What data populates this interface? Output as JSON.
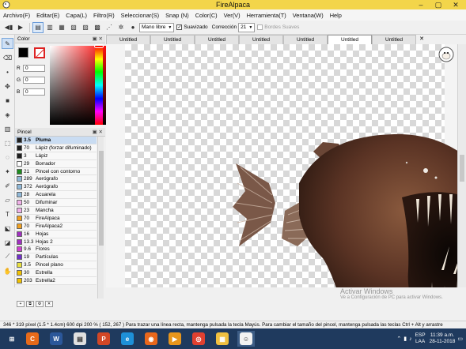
{
  "window": {
    "title": "FireAlpaca",
    "controls": [
      "–",
      "▢",
      "✕"
    ]
  },
  "menu": [
    "Archivo(F)",
    "Editar(E)",
    "Capa(L)",
    "Filtro(R)",
    "Seleccionar(S)",
    "Snap (N)",
    "Color(C)",
    "Ver(V)",
    "Herramienta(T)",
    "Ventana(W)",
    "Help"
  ],
  "toolbar": {
    "mode_value": "Mano libre",
    "smooth_label": "Suavizado",
    "correction_label": "Corrección",
    "correction_value": "21",
    "soft_edges_label": "Bordes Suaves"
  },
  "color_panel": {
    "title": "Color",
    "r_label": "R",
    "r_value": "0",
    "g_label": "G",
    "g_value": "0",
    "b_label": "B",
    "b_value": "0",
    "fg_color": "#000000",
    "bg_color": "#ffffff"
  },
  "brush_panel": {
    "title": "Pincel",
    "items": [
      {
        "size": "3.5",
        "name": "Pluma",
        "color": "#1e1e1e"
      },
      {
        "size": "70",
        "name": "Lápiz (forzar difuminado)",
        "color": "#1e1e1e"
      },
      {
        "size": "3",
        "name": "Lápiz",
        "color": "#1e1e1e"
      },
      {
        "size": "29",
        "name": "Borrador",
        "color": "#ffffff"
      },
      {
        "size": "21",
        "name": "Pincel con contorno",
        "color": "#1e8c1e"
      },
      {
        "size": "289",
        "name": "Aerógrafo",
        "color": "#8fb8d8"
      },
      {
        "size": "372",
        "name": "Aerógrafo",
        "color": "#8fb8d8"
      },
      {
        "size": "28",
        "name": "Acuarela",
        "color": "#8fb8d8"
      },
      {
        "size": "50",
        "name": "Difuminar",
        "color": "#f0b0e8"
      },
      {
        "size": "23",
        "name": "Mancha",
        "color": "#f0b0e8"
      },
      {
        "size": "70",
        "name": "FireAlpaca",
        "color": "#f0a020"
      },
      {
        "size": "70",
        "name": "FireAlpaca2",
        "color": "#f0a020"
      },
      {
        "size": "16",
        "name": "Hojas",
        "color": "#a030c0"
      },
      {
        "size": "13.3",
        "name": "Hojas 2",
        "color": "#a030c0"
      },
      {
        "size": "9.6",
        "name": "Flores",
        "color": "#d040d0"
      },
      {
        "size": "19",
        "name": "Partículas",
        "color": "#7030c8"
      },
      {
        "size": "3.5",
        "name": "Pincel plano",
        "color": "#e8e040"
      },
      {
        "size": "30",
        "name": "Estrella",
        "color": "#f0c000"
      },
      {
        "size": "203",
        "name": "Estrella2",
        "color": "#f0c000"
      }
    ]
  },
  "tabs": [
    "Untitled",
    "Untitled",
    "Untitled",
    "Untitled",
    "Untitled",
    "Untitled",
    "Untitled"
  ],
  "active_tab_index": 5,
  "watermark": {
    "title": "Activar Windows",
    "subtitle": "Ve a Configuración de PC para activar Windows."
  },
  "status": "346 * 319 píxel  (1.5 * 1.4cm)  600 dpi  200 %  ( 152, 267 )  Para trazar una línea recta, mantenga pulsada la tecla Mayús. Para cambiar el tamaño del pincel, mantenga pulsada las teclas Ctrl + Alt y arrastre",
  "taskbar": {
    "apps": [
      {
        "name": "windows-start",
        "color": "#1f3a5e"
      },
      {
        "name": "chrome-c",
        "color": "#e66a1a"
      },
      {
        "name": "word",
        "color": "#2b579a"
      },
      {
        "name": "notes",
        "color": "#e0e0e0"
      },
      {
        "name": "powerpoint",
        "color": "#d24726"
      },
      {
        "name": "internet-explorer",
        "color": "#1e90d8"
      },
      {
        "name": "firefox",
        "color": "#e8671c"
      },
      {
        "name": "media-player",
        "color": "#e8961c"
      },
      {
        "name": "chrome",
        "color": "#e04030"
      },
      {
        "name": "file-explorer",
        "color": "#f0c040"
      },
      {
        "name": "firealpaca",
        "color": "#f2f2f2"
      }
    ],
    "lang_top": "ESP",
    "lang_bottom": "LAA",
    "time": "11:39 a.m.",
    "date": "28-11-2018"
  }
}
